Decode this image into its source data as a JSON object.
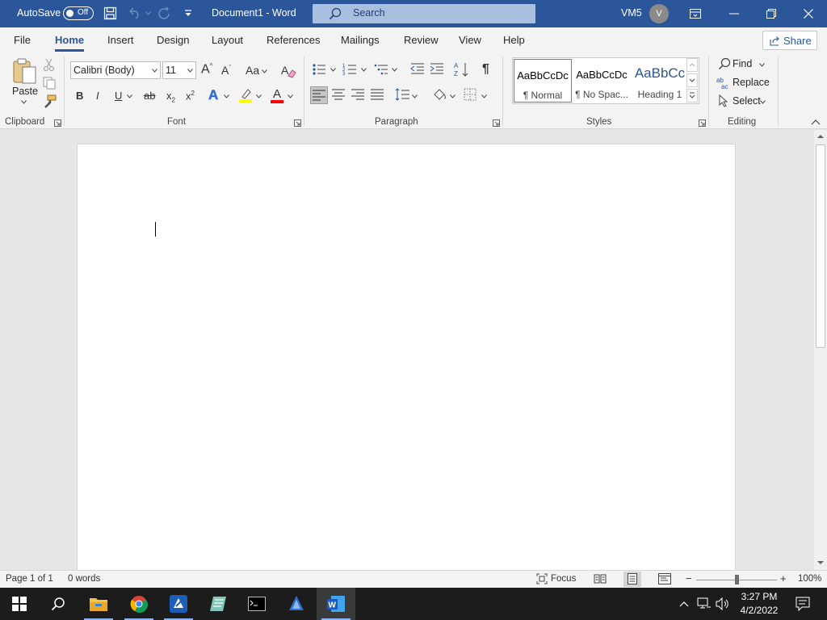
{
  "titlebar": {
    "autosave_label": "AutoSave",
    "autosave_state": "Off",
    "doc_title": "Document1 - Word",
    "search_placeholder": "Search",
    "user_name": "VM5",
    "user_initial": "V"
  },
  "tabs": [
    "File",
    "Home",
    "Insert",
    "Design",
    "Layout",
    "References",
    "Mailings",
    "Review",
    "View",
    "Help"
  ],
  "active_tab": "Home",
  "share_label": "Share",
  "ribbon": {
    "clipboard": {
      "paste_label": "Paste",
      "group_label": "Clipboard"
    },
    "font": {
      "font_name": "Calibri (Body)",
      "font_size": "11",
      "group_label": "Font",
      "bold": "B",
      "italic": "I",
      "underline": "U",
      "strike": "ab",
      "subscript": "x",
      "subscript_mark": "2",
      "superscript": "x",
      "superscript_mark": "2",
      "grow": "A",
      "shrink": "A",
      "case": "Aa",
      "text_effects": "A",
      "font_color": "A",
      "highlight_color": "#ffff00",
      "font_color_bar": "#ff0000"
    },
    "paragraph": {
      "group_label": "Paragraph"
    },
    "styles": {
      "group_label": "Styles",
      "items": [
        {
          "sample": "AaBbCcDc",
          "name": "¶ Normal"
        },
        {
          "sample": "AaBbCcDc",
          "name": "¶ No Spac..."
        },
        {
          "sample": "AaBbCc",
          "name": "Heading 1"
        }
      ]
    },
    "editing": {
      "group_label": "Editing",
      "find": "Find",
      "replace": "Replace",
      "select": "Select"
    }
  },
  "status": {
    "page": "Page 1 of 1",
    "words": "0 words",
    "focus": "Focus",
    "zoom": "100%",
    "zoom_minus": "−",
    "zoom_plus": "+"
  },
  "taskbar": {
    "apps": [
      "start-icon",
      "search-icon",
      "file-explorer-icon",
      "chrome-icon",
      "app-icon",
      "app-icon",
      "terminal-icon",
      "app-icon",
      "word-icon"
    ],
    "time": "3:27 PM",
    "date": "4/2/2022"
  },
  "colors": {
    "accent": "#2b579a",
    "ribbon_bg": "#f3f3f3",
    "taskbar_bg": "#1c1c1c"
  }
}
